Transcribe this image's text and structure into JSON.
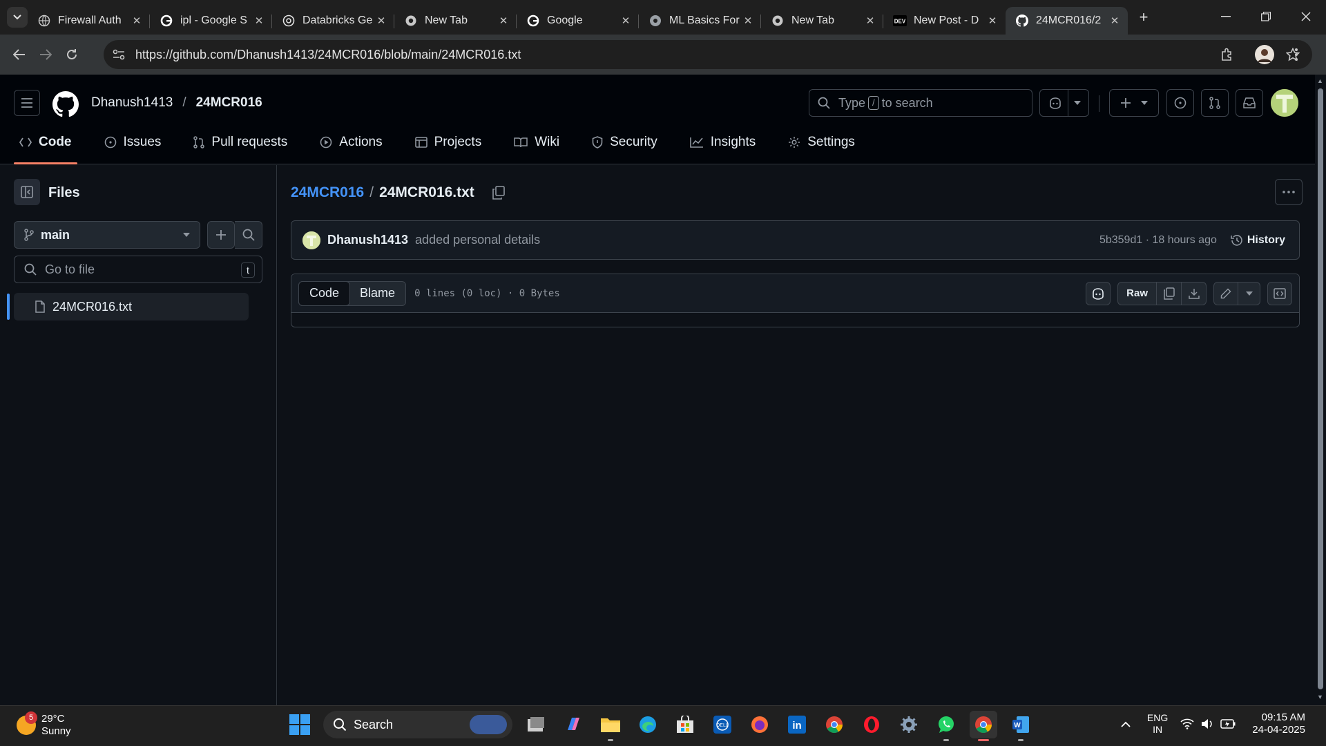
{
  "browser": {
    "tabs": [
      {
        "label": "Firewall Auth",
        "icon": "globe-icon"
      },
      {
        "label": "ipl - Google S",
        "icon": "google-icon"
      },
      {
        "label": "Databricks Ge",
        "icon": "openai-icon"
      },
      {
        "label": "New Tab",
        "icon": "chrome-icon"
      },
      {
        "label": "Google",
        "icon": "google-icon"
      },
      {
        "label": "ML Basics For",
        "icon": "medium-icon"
      },
      {
        "label": "New Tab",
        "icon": "chrome-icon"
      },
      {
        "label": "New Post - D",
        "icon": "dev-icon"
      },
      {
        "label": "24MCR016/2",
        "icon": "github-icon",
        "active": true
      }
    ],
    "url": "https://github.com/Dhanush1413/24MCR016/blob/main/24MCR016.txt"
  },
  "header": {
    "owner": "Dhanush1413",
    "separator": "/",
    "repo": "24MCR016",
    "search_before": "Type",
    "search_key": "/",
    "search_after": "to search"
  },
  "repo_nav": [
    {
      "label": "Code",
      "icon": "code-icon",
      "active": true
    },
    {
      "label": "Issues",
      "icon": "issue-icon"
    },
    {
      "label": "Pull requests",
      "icon": "pull-request-icon"
    },
    {
      "label": "Actions",
      "icon": "play-icon"
    },
    {
      "label": "Projects",
      "icon": "table-icon"
    },
    {
      "label": "Wiki",
      "icon": "book-icon"
    },
    {
      "label": "Security",
      "icon": "shield-icon"
    },
    {
      "label": "Insights",
      "icon": "graph-icon"
    },
    {
      "label": "Settings",
      "icon": "gear-icon"
    }
  ],
  "sidebar": {
    "title": "Files",
    "branch": "main",
    "goto_placeholder": "Go to file",
    "goto_key": "t",
    "files": [
      {
        "name": "24MCR016.txt",
        "selected": true
      }
    ]
  },
  "main": {
    "breadcrumb_root": "24MCR016",
    "breadcrumb_sep": "/",
    "breadcrumb_file": "24MCR016.txt",
    "commit": {
      "author": "Dhanush1413",
      "message": "added personal details",
      "hash_time": "5b359d1 · 18 hours ago",
      "history_label": "History"
    },
    "file": {
      "tab_code": "Code",
      "tab_blame": "Blame",
      "meta": "0 lines (0 loc) · 0 Bytes",
      "raw_label": "Raw"
    }
  },
  "taskbar": {
    "weather_badge": "5",
    "temperature": "29°C",
    "condition": "Sunny",
    "search_label": "Search",
    "lang_top": "ENG",
    "lang_bottom": "IN",
    "time": "09:15 AM",
    "date": "24-04-2025"
  },
  "colors": {
    "accent_link": "#4493f8",
    "nav_underline": "#f78166",
    "background": "#0d1117",
    "header_bg": "#010409"
  }
}
